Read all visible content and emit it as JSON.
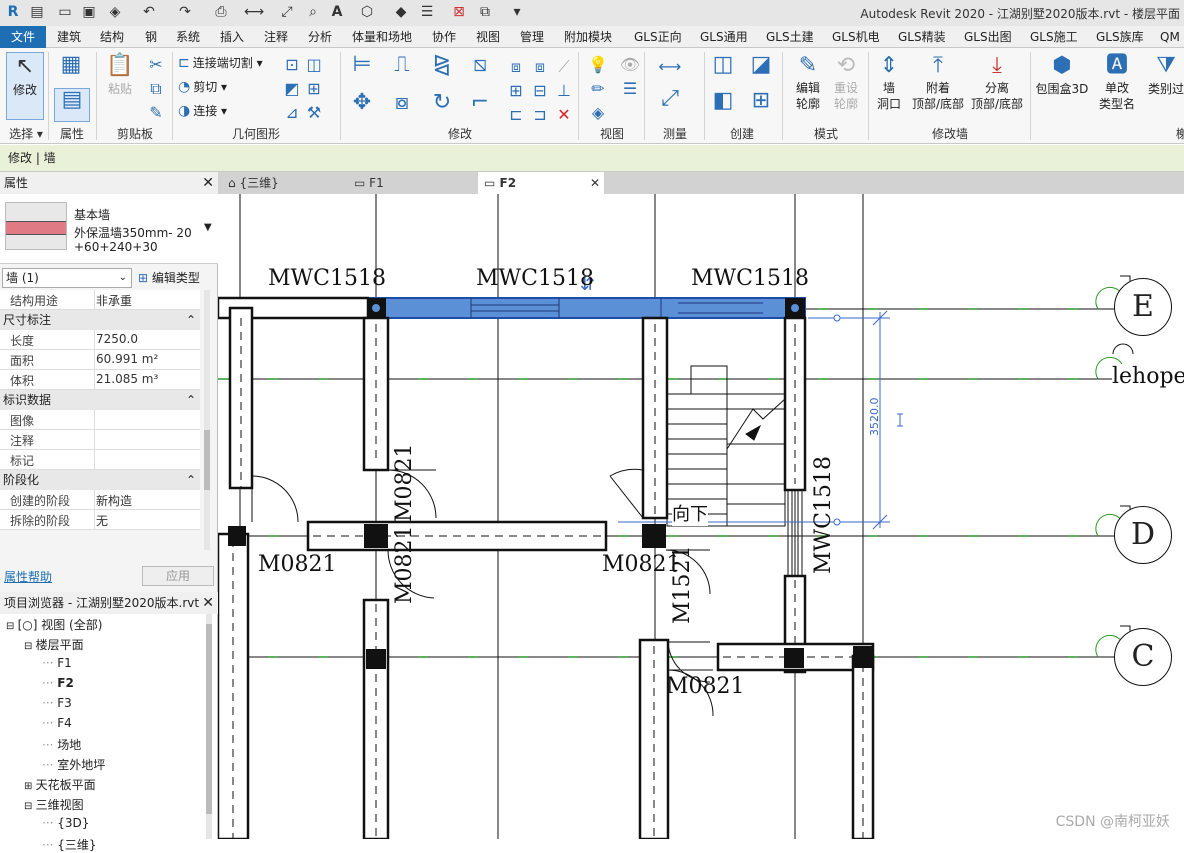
{
  "app": {
    "title": "Autodesk Revit 2020 - 江湖别墅2020版本.rvt - 楼层平面"
  },
  "menu": [
    "文件",
    "建筑",
    "结构",
    "钢",
    "系统",
    "插入",
    "注释",
    "分析",
    "体量和场地",
    "协作",
    "视图",
    "管理",
    "附加模块",
    "GLS正向",
    "GLS通用",
    "GLS土建",
    "GLS机电",
    "GLS精装",
    "GLS出图",
    "GLS施工",
    "GLS族库",
    "QM"
  ],
  "ribbon": {
    "modify": "修改",
    "paste": "粘贴",
    "join_cut": "连接端切割",
    "cut": "剪切",
    "join": "连接",
    "edit_profile": [
      "编辑",
      "轮廓"
    ],
    "reset_profile": [
      "重设",
      "轮廓"
    ],
    "wall_opening": [
      "墙",
      "洞口"
    ],
    "attach": [
      "附着",
      "顶部/底部"
    ],
    "detach": [
      "分离",
      "顶部/底部"
    ],
    "bbox3d": "包围盒3D",
    "single_change": [
      "单改",
      "类型名"
    ],
    "class_filter": "类别过",
    "panels": {
      "select": "选择",
      "properties": "属性",
      "clipboard": "剪贴板",
      "geometry": "几何图形",
      "modify": "修改",
      "view": "视图",
      "measure": "测量",
      "create": "创建",
      "mode": "模式",
      "modify_wall": "修改墙",
      "last": "榭"
    }
  },
  "context_bar": "修改 | 墙",
  "properties": {
    "header": "属性",
    "type_family": "基本墙",
    "type_name_1": "外保温墙350mm- 20",
    "type_name_2": "+60+240+30",
    "instance_selector": "墙 (1)",
    "edit_type": "编辑类型",
    "rows": [
      {
        "kind": "row",
        "k": "结构用途",
        "v": "非承重",
        "grey": true
      },
      {
        "kind": "group",
        "k": "尺寸标注"
      },
      {
        "kind": "row",
        "k": "长度",
        "v": "7250.0",
        "grey": true
      },
      {
        "kind": "row",
        "k": "面积",
        "v": "60.991 m²",
        "grey": true
      },
      {
        "kind": "row",
        "k": "体积",
        "v": "21.085 m³",
        "grey": true
      },
      {
        "kind": "group",
        "k": "标识数据"
      },
      {
        "kind": "row",
        "k": "图像",
        "v": ""
      },
      {
        "kind": "row",
        "k": "注释",
        "v": ""
      },
      {
        "kind": "row",
        "k": "标记",
        "v": ""
      },
      {
        "kind": "group",
        "k": "阶段化"
      },
      {
        "kind": "row",
        "k": "创建的阶段",
        "v": "新构造"
      },
      {
        "kind": "row",
        "k": "拆除的阶段",
        "v": "无"
      }
    ],
    "help": "属性帮助",
    "apply": "应用"
  },
  "browser": {
    "header": "项目浏览器 - 江湖别墅2020版本.rvt",
    "items": [
      {
        "t": "[○] 视图 (全部)",
        "lvl": 0,
        "tog": "⊟"
      },
      {
        "t": "楼层平面",
        "lvl": 1,
        "tog": "⊟"
      },
      {
        "t": "F1",
        "lvl": 2
      },
      {
        "t": "F2",
        "lvl": 2,
        "bold": true
      },
      {
        "t": "F3",
        "lvl": 2
      },
      {
        "t": "F4",
        "lvl": 2
      },
      {
        "t": "场地",
        "lvl": 2
      },
      {
        "t": "室外地坪",
        "lvl": 2
      },
      {
        "t": "天花板平面",
        "lvl": 1,
        "tog": "⊞"
      },
      {
        "t": "三维视图",
        "lvl": 1,
        "tog": "⊟"
      },
      {
        "t": "{3D}",
        "lvl": 2
      },
      {
        "t": "{三维}",
        "lvl": 2
      }
    ]
  },
  "tabs": [
    {
      "label": "{三维}",
      "icon": "cube-icon"
    },
    {
      "label": "F1",
      "icon": "plan-icon"
    },
    {
      "label": "F2",
      "icon": "plan-icon",
      "active": true
    }
  ],
  "drawing": {
    "labels": {
      "win1": "MWC1518",
      "win2": "MWC1518",
      "win3": "MWC1518",
      "win4": "MWC1518",
      "door1": "M0821",
      "door2": "M0821",
      "door3": "M0821",
      "door4": "M0821",
      "door5": "M0821",
      "door6": "M1521",
      "stair": "向下",
      "dim": "3520.0",
      "grid_e": "E",
      "grid_d": "D",
      "grid_c": "C",
      "sketch": "lehope"
    }
  },
  "watermark": "CSDN @南柯亚妖",
  "colors": {
    "accent": "#1e6eb4",
    "selection": "#5b8fd6",
    "context_bar": "#e9f1d8",
    "grid": "#2a9a2a"
  }
}
